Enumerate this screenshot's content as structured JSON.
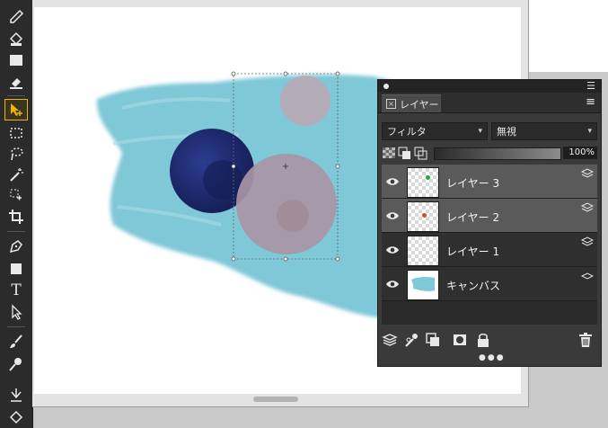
{
  "toolbar": {
    "tools": [
      {
        "name": "eyedropper-icon"
      },
      {
        "name": "paint-bucket-icon"
      },
      {
        "name": "gradient-icon"
      },
      {
        "name": "eraser-icon"
      },
      {
        "name": "move-tool-icon",
        "active": true
      },
      {
        "name": "rect-select-icon"
      },
      {
        "name": "lasso-icon"
      },
      {
        "name": "magic-wand-icon"
      },
      {
        "name": "transform-icon"
      },
      {
        "name": "crop-icon"
      },
      {
        "name": "pen-icon"
      },
      {
        "name": "shape-icon"
      },
      {
        "name": "text-tool-icon",
        "glyph": "T"
      },
      {
        "name": "direct-select-icon"
      },
      {
        "name": "brush-icon"
      },
      {
        "name": "blend-brush-icon"
      },
      {
        "name": "smudge-icon"
      },
      {
        "name": "fill-tool-icon"
      }
    ]
  },
  "layers_panel": {
    "tab_label": "レイヤー",
    "filter_label": "フィルタ",
    "blend_mode": "無視",
    "opacity": "100%",
    "opacity_level": 1.0,
    "layers": [
      {
        "name": "レイヤー 3",
        "selected": true,
        "dot_color": "#22aa44"
      },
      {
        "name": "レイヤー 2",
        "selected": true,
        "dot_color": "#d0502a"
      },
      {
        "name": "レイヤー 1",
        "selected": false
      },
      {
        "name": "キャンバス",
        "selected": false
      }
    ]
  },
  "colors": {
    "accent_active_tool": "#f0b400",
    "paint_cyan": "#7fc8d8",
    "paint_navy": "#1f2a6e"
  }
}
